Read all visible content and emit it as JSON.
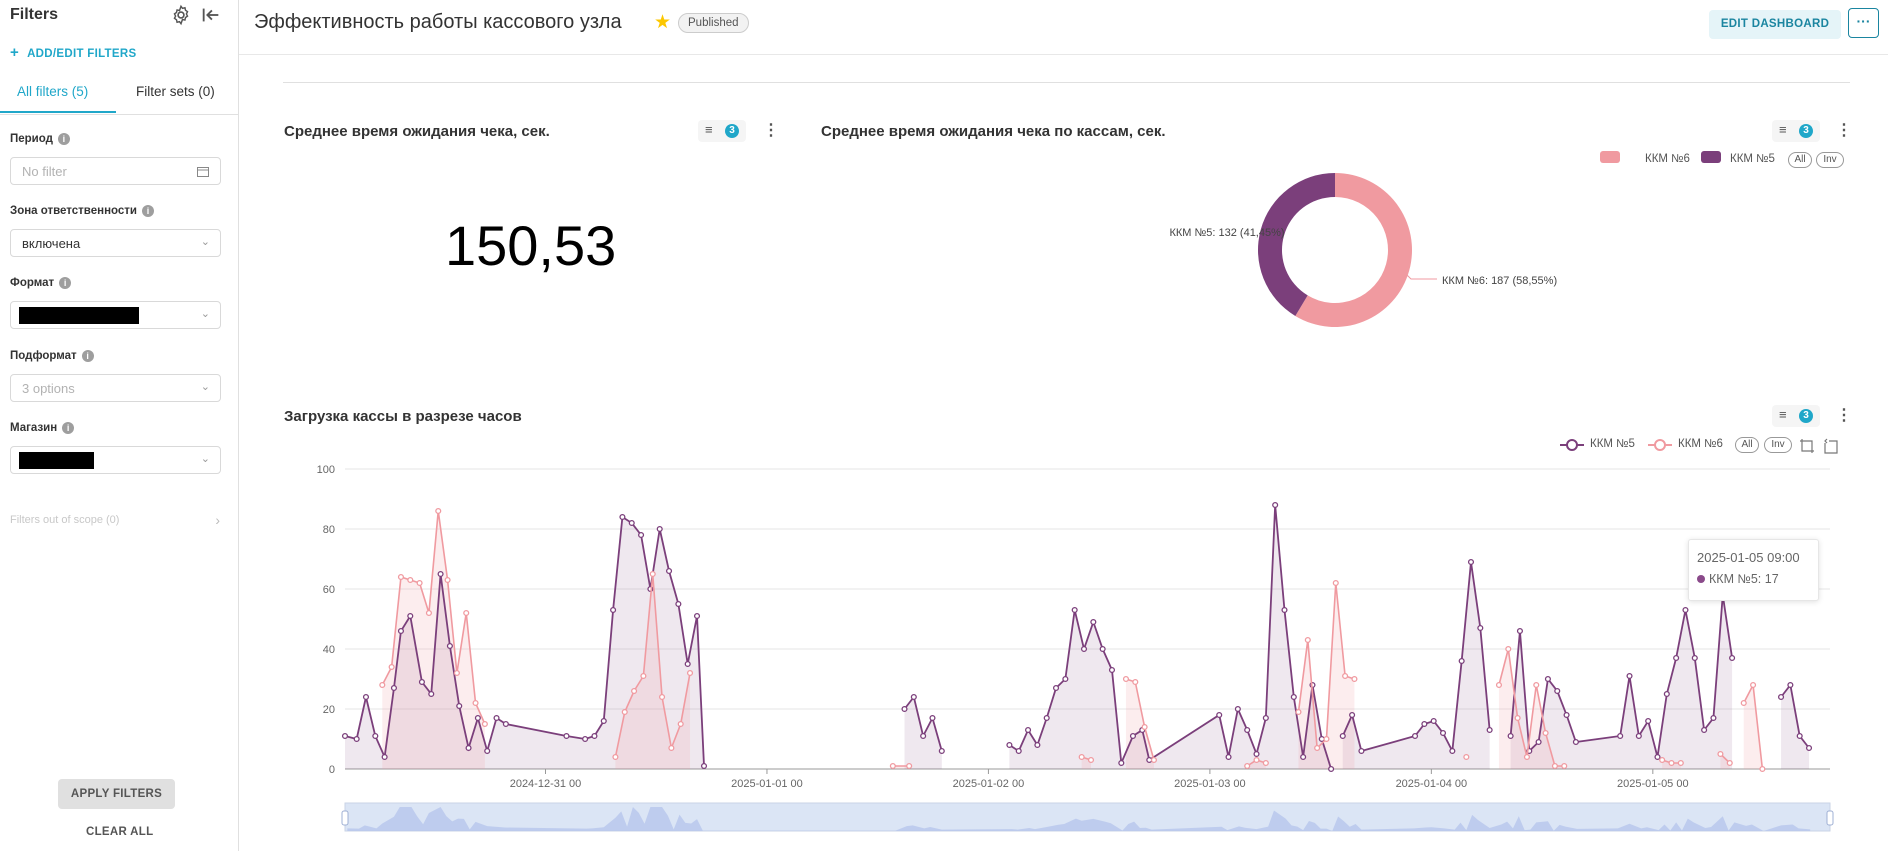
{
  "sidebar": {
    "title": "Filters",
    "add_edit_label": "ADD/EDIT FILTERS",
    "tab_all": "All filters (5)",
    "tab_sets": "Filter sets (0)",
    "filters": [
      {
        "label": "Период",
        "value": "No filter",
        "placeholder": true
      },
      {
        "label": "Зона ответственности",
        "value": "включена",
        "placeholder": false
      },
      {
        "label": "Формат",
        "value": "",
        "redacted": true
      },
      {
        "label": "Подформат",
        "value": "3 options",
        "placeholder": true
      },
      {
        "label": "Магазин",
        "value": "",
        "redacted": true
      }
    ],
    "out_of_scope": "Filters out of scope (0)",
    "apply_label": "APPLY FILTERS",
    "clear_label": "CLEAR ALL"
  },
  "header": {
    "title": "Эффективность работы кассового узла",
    "status": "Published",
    "edit_label": "EDIT DASHBOARD",
    "more_label": "···"
  },
  "colors": {
    "accent": "#20a7c9",
    "series5": "#7b3f7b",
    "series6": "#f09aa0"
  },
  "charts": {
    "big_number": {
      "title": "Среднее время ожидания чека, сек.",
      "value": "150,53",
      "filter_count": "3"
    },
    "donut": {
      "title": "Среднее время ожидания чека по кассам, сек.",
      "filter_count": "3"
    },
    "line": {
      "title": "Загрузка кассы в разрезе часов",
      "filter_count": "3"
    }
  },
  "legend": {
    "all": "All",
    "inv": "Inv"
  },
  "tooltip": {
    "time": "2025-01-05 09:00",
    "series": "ККМ №5: 17"
  },
  "chart_data": [
    {
      "type": "pie",
      "title": "Среднее время ожидания чека по кассам, сек.",
      "donut": true,
      "legend_position": "top-right",
      "slices": [
        {
          "name": "ККМ №6",
          "value": 187,
          "percent": "58,55%",
          "label": "ККМ №6: 187 (58,55%)",
          "color": "#f09aa0"
        },
        {
          "name": "ККМ №5",
          "value": 132,
          "percent": "41,45%",
          "label": "ККМ №5: 132 (41,45%)",
          "color": "#7b3f7b"
        }
      ]
    },
    {
      "type": "line",
      "title": "Загрузка кассы в разрезе часов",
      "legend_position": "top-right",
      "grid": true,
      "ylim": [
        0,
        100
      ],
      "yticks": [
        0,
        20,
        40,
        60,
        80,
        100
      ],
      "xlim": [
        -3.2,
        124.2
      ],
      "xticks": [
        {
          "x": 14,
          "label": "2024-12-31 00"
        },
        {
          "x": 33,
          "label": "2025-01-01 00"
        },
        {
          "x": 52,
          "label": "2025-01-02 00"
        },
        {
          "x": 71,
          "label": "2025-01-03 00"
        },
        {
          "x": 90,
          "label": "2025-01-04 00"
        },
        {
          "x": 109,
          "label": "2025-01-05 00"
        }
      ],
      "series": [
        {
          "name": "ККМ №5",
          "color": "#7b3f7b",
          "segments": [
            [
              [
                -3.2,
                11
              ],
              [
                -2.2,
                10
              ],
              [
                -1.4,
                24
              ],
              [
                -0.6,
                11
              ],
              [
                0.2,
                4
              ],
              [
                1,
                27
              ],
              [
                1.6,
                46
              ],
              [
                2.4,
                51
              ],
              [
                3.4,
                29
              ],
              [
                4.2,
                25
              ],
              [
                5,
                65
              ],
              [
                5.8,
                41
              ],
              [
                6.6,
                21
              ],
              [
                7.4,
                7
              ],
              [
                8.2,
                17
              ],
              [
                9,
                6
              ],
              [
                9.8,
                17
              ],
              [
                10.6,
                15
              ],
              [
                15.8,
                11
              ],
              [
                17.4,
                10
              ],
              [
                18.2,
                11
              ],
              [
                19,
                16
              ],
              [
                19.8,
                53
              ],
              [
                20.6,
                84
              ],
              [
                21.4,
                82
              ],
              [
                22.2,
                78
              ],
              [
                23,
                60
              ],
              [
                23.8,
                80
              ],
              [
                24.6,
                66
              ],
              [
                25.4,
                55
              ],
              [
                26.2,
                35
              ],
              [
                27,
                51
              ],
              [
                27.6,
                1
              ]
            ],
            [
              [
                44.8,
                20
              ],
              [
                45.6,
                24
              ],
              [
                46.4,
                11
              ],
              [
                47.2,
                17
              ],
              [
                48,
                6
              ]
            ],
            [
              [
                53.8,
                8
              ],
              [
                54.6,
                6
              ],
              [
                55.4,
                13
              ],
              [
                56.2,
                8
              ],
              [
                57,
                17
              ],
              [
                57.8,
                27
              ],
              [
                58.6,
                30
              ],
              [
                59.4,
                53
              ],
              [
                60.2,
                40
              ],
              [
                61,
                49
              ],
              [
                61.8,
                40
              ],
              [
                62.6,
                33
              ],
              [
                63.4,
                2
              ],
              [
                64.4,
                11
              ],
              [
                65.2,
                13
              ],
              [
                65.8,
                3
              ],
              [
                71.8,
                18
              ],
              [
                72.6,
                4
              ],
              [
                73.4,
                20
              ],
              [
                74.2,
                13
              ],
              [
                75,
                5
              ],
              [
                75.8,
                17
              ],
              [
                76.6,
                88
              ],
              [
                77.4,
                53
              ],
              [
                78.2,
                24
              ],
              [
                79,
                4
              ],
              [
                79.8,
                28
              ],
              [
                80.6,
                10
              ],
              [
                81.4,
                0
              ]
            ],
            [
              [
                82.4,
                11
              ],
              [
                83.2,
                18
              ],
              [
                84,
                6
              ],
              [
                88.6,
                11
              ],
              [
                89.4,
                15
              ],
              [
                90.2,
                16
              ],
              [
                91,
                12
              ],
              [
                91.8,
                6
              ],
              [
                92.6,
                36
              ],
              [
                93.4,
                69
              ],
              [
                94.2,
                47
              ],
              [
                95,
                13
              ]
            ],
            [
              [
                96.8,
                11
              ],
              [
                97.6,
                46
              ],
              [
                98.4,
                6
              ],
              [
                99.2,
                9
              ],
              [
                100,
                30
              ],
              [
                100.8,
                26
              ],
              [
                101.6,
                18
              ],
              [
                102.4,
                9
              ],
              [
                106.2,
                11
              ],
              [
                107,
                31
              ],
              [
                107.8,
                11
              ],
              [
                108.6,
                16
              ],
              [
                109.4,
                4
              ],
              [
                110.2,
                25
              ],
              [
                111,
                37
              ],
              [
                111.8,
                53
              ],
              [
                112.6,
                37
              ],
              [
                113.4,
                13
              ],
              [
                114.2,
                17
              ],
              [
                115,
                58
              ],
              [
                115.8,
                37
              ]
            ],
            [
              [
                120,
                24
              ],
              [
                120.8,
                28
              ],
              [
                121.6,
                11
              ],
              [
                122.4,
                7
              ]
            ]
          ]
        },
        {
          "name": "ККМ №6",
          "color": "#f09aa0",
          "segments": [
            [
              [
                0,
                28
              ],
              [
                0.8,
                34
              ],
              [
                1.6,
                64
              ],
              [
                2.4,
                63
              ],
              [
                3.2,
                62
              ],
              [
                4,
                52
              ],
              [
                4.8,
                86
              ],
              [
                5.6,
                63
              ],
              [
                6.4,
                32
              ],
              [
                7.2,
                52
              ],
              [
                8,
                22
              ],
              [
                8.8,
                15
              ]
            ],
            [
              [
                20,
                4
              ],
              [
                20.8,
                19
              ],
              [
                21.6,
                26
              ],
              [
                22.4,
                31
              ],
              [
                23.2,
                65
              ],
              [
                24,
                24
              ],
              [
                24.8,
                7
              ],
              [
                25.6,
                15
              ],
              [
                26.4,
                32
              ]
            ],
            [
              [
                43.8,
                1
              ],
              [
                45.2,
                1
              ]
            ],
            [
              [
                60,
                4
              ],
              [
                60.8,
                3
              ]
            ],
            [
              [
                63.8,
                30
              ],
              [
                64.6,
                29
              ],
              [
                65.4,
                14
              ],
              [
                66.2,
                3
              ]
            ],
            [
              [
                74.2,
                1
              ],
              [
                75,
                3
              ],
              [
                75.8,
                2
              ]
            ],
            [
              [
                78.6,
                19
              ],
              [
                79.4,
                43
              ],
              [
                80.2,
                7
              ],
              [
                81,
                10
              ],
              [
                81.8,
                62
              ],
              [
                82.6,
                31
              ],
              [
                83.4,
                30
              ]
            ],
            [
              [
                93,
                4
              ]
            ],
            [
              [
                95.8,
                28
              ],
              [
                96.6,
                40
              ],
              [
                97.4,
                17
              ],
              [
                98.2,
                4
              ],
              [
                99,
                28
              ],
              [
                99.8,
                12
              ],
              [
                100.6,
                1
              ],
              [
                101.4,
                1
              ]
            ],
            [
              [
                109.8,
                3
              ],
              [
                110.6,
                2
              ],
              [
                111.4,
                2
              ]
            ],
            [
              [
                114.8,
                5
              ],
              [
                115.6,
                2
              ]
            ],
            [
              [
                116.8,
                22
              ],
              [
                117.6,
                28
              ],
              [
                118.4,
                0
              ]
            ]
          ]
        }
      ]
    }
  ]
}
